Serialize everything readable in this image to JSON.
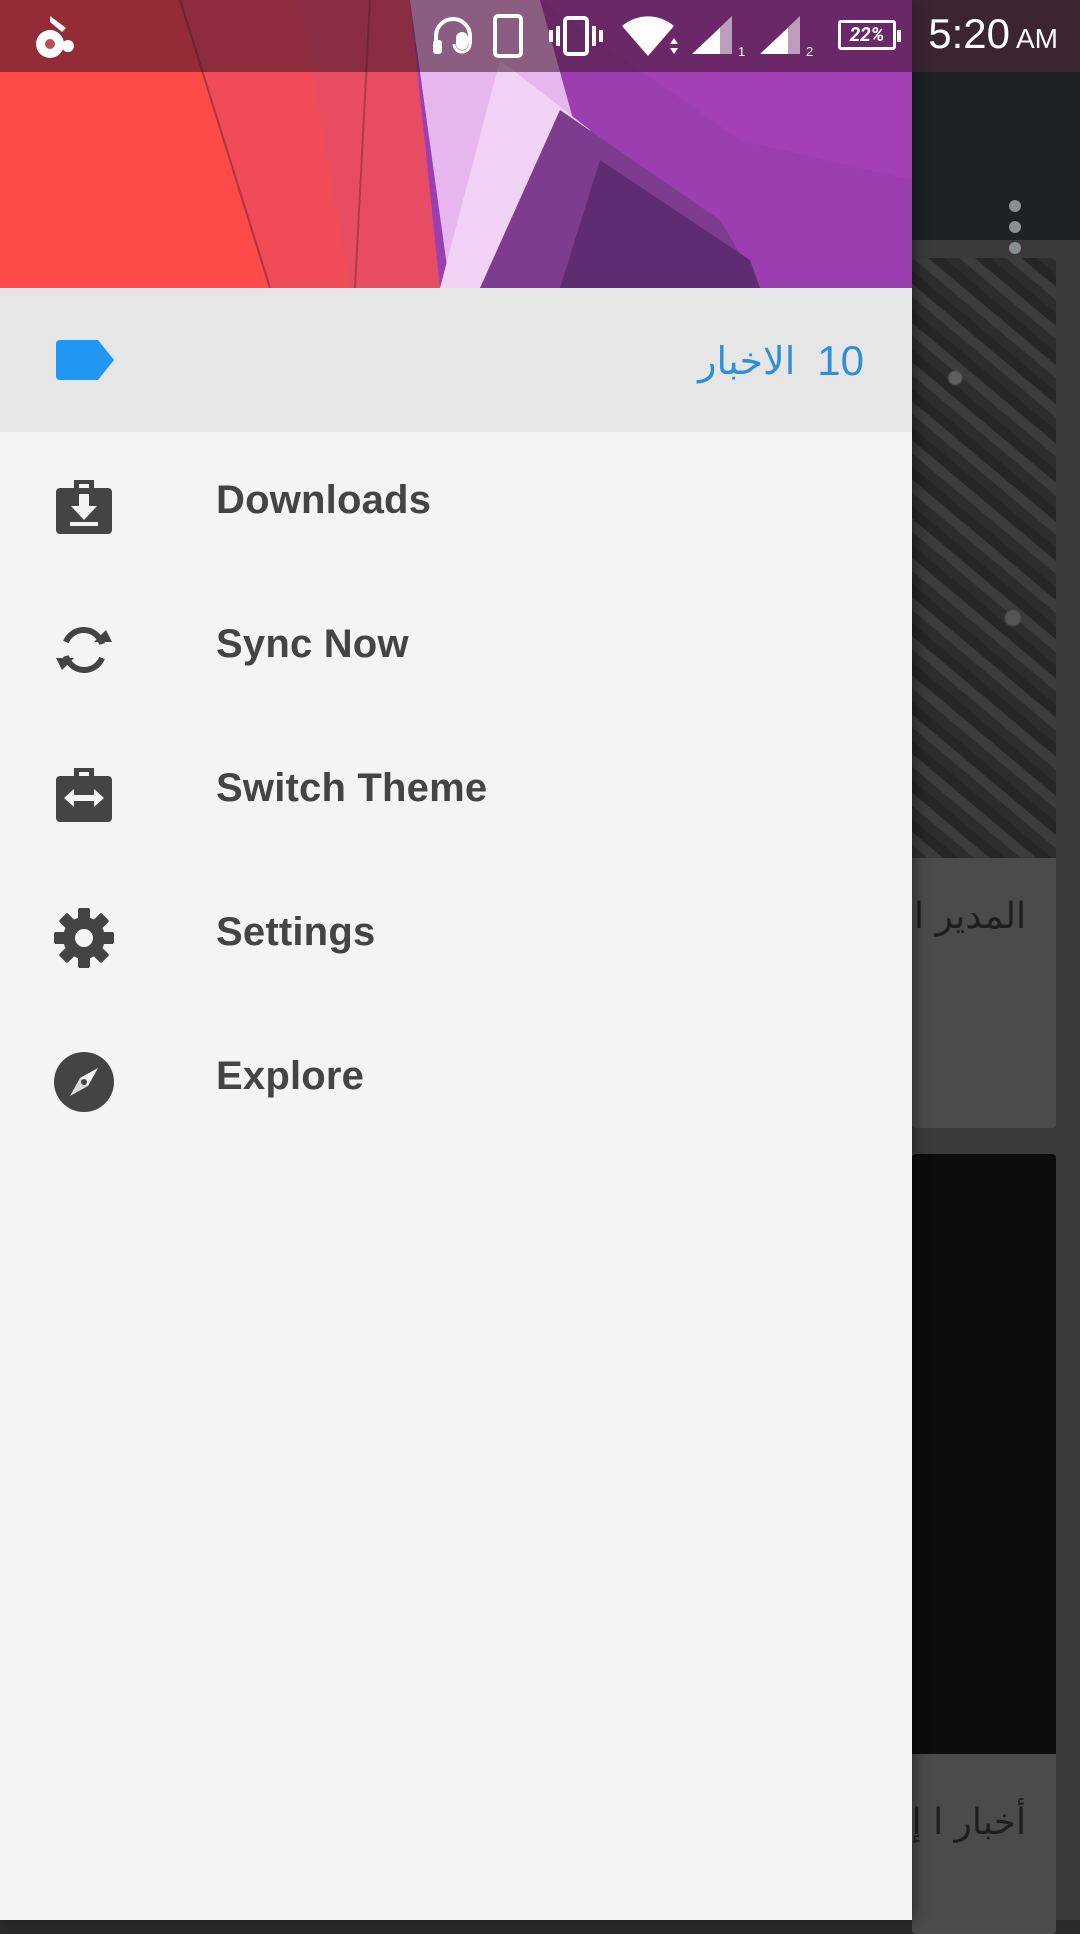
{
  "status_bar": {
    "time": "5:20",
    "ampm": "AM",
    "battery": "22%",
    "sim1": "1",
    "sim2": "2",
    "icons": [
      "app-notification-icon",
      "headset-mic-icon",
      "phone-icon",
      "vibrate-icon",
      "wifi-icon",
      "signal-sim1-icon",
      "signal-sim2-icon",
      "battery-icon"
    ]
  },
  "drawer": {
    "selected_item": {
      "count": "10",
      "title": "الاخبار",
      "icon": "label-icon",
      "color": "#2e8fd6"
    },
    "items": [
      {
        "label": "Downloads",
        "icon": "download-bag-icon"
      },
      {
        "label": "Sync Now",
        "icon": "sync-icon"
      },
      {
        "label": "Switch Theme",
        "icon": "switch-theme-icon"
      },
      {
        "label": "Settings",
        "icon": "gear-icon"
      },
      {
        "label": "Explore",
        "icon": "compass-icon"
      }
    ]
  },
  "background": {
    "card1_text": "المدير التعاقد",
    "card2_text": "أخبار ا إلى مان"
  }
}
